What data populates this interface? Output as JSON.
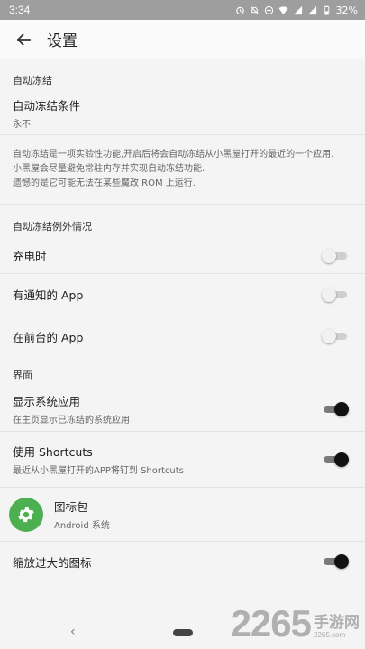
{
  "status_bar": {
    "time": "3:34",
    "battery": "32%",
    "icons": [
      "alarm-icon",
      "notifications-off-icon",
      "do-not-disturb-icon",
      "wifi-icon",
      "signal-icon",
      "signal-icon",
      "battery-icon"
    ]
  },
  "app_bar": {
    "title": "设置",
    "back_icon": "arrow-back-icon"
  },
  "auto_freeze": {
    "header": "自动冻结",
    "condition": {
      "title": "自动冻结条件",
      "summary": "永不"
    },
    "description": [
      "自动冻结是一项实验性功能,开启后将会自动冻结从小黑屋打开的最近的一个应用.",
      "小黑屋会尽量避免常驻内存并实现自动冻结功能.",
      "遗憾的是它可能无法在某些魔改 ROM 上运行."
    ]
  },
  "exceptions": {
    "header": "自动冻结例外情况",
    "items": [
      {
        "title": "充电时",
        "enabled": false
      },
      {
        "title": "有通知的 App",
        "enabled": false
      },
      {
        "title": "在前台的 App",
        "enabled": false
      }
    ]
  },
  "interface": {
    "header": "界面",
    "show_system_apps": {
      "title": "显示系统应用",
      "summary": "在主页显示已冻结的系统应用",
      "enabled": true
    },
    "shortcuts": {
      "title": "使用 Shortcuts",
      "summary": "最近从小黑屋打开的APP将钉到 Shortcuts",
      "enabled": true
    },
    "icon_pack": {
      "title": "图标包",
      "summary": "Android 系统",
      "icon": "gear-icon"
    },
    "scale_icons": {
      "title": "缩放过大的图标",
      "enabled": true
    }
  },
  "watermark": {
    "number": "2265",
    "text": "手游网",
    "url": "2265.com"
  },
  "colors": {
    "accent_green": "#4caf50",
    "switch_on": "#111111",
    "status_bar": "#9e9e9e"
  }
}
